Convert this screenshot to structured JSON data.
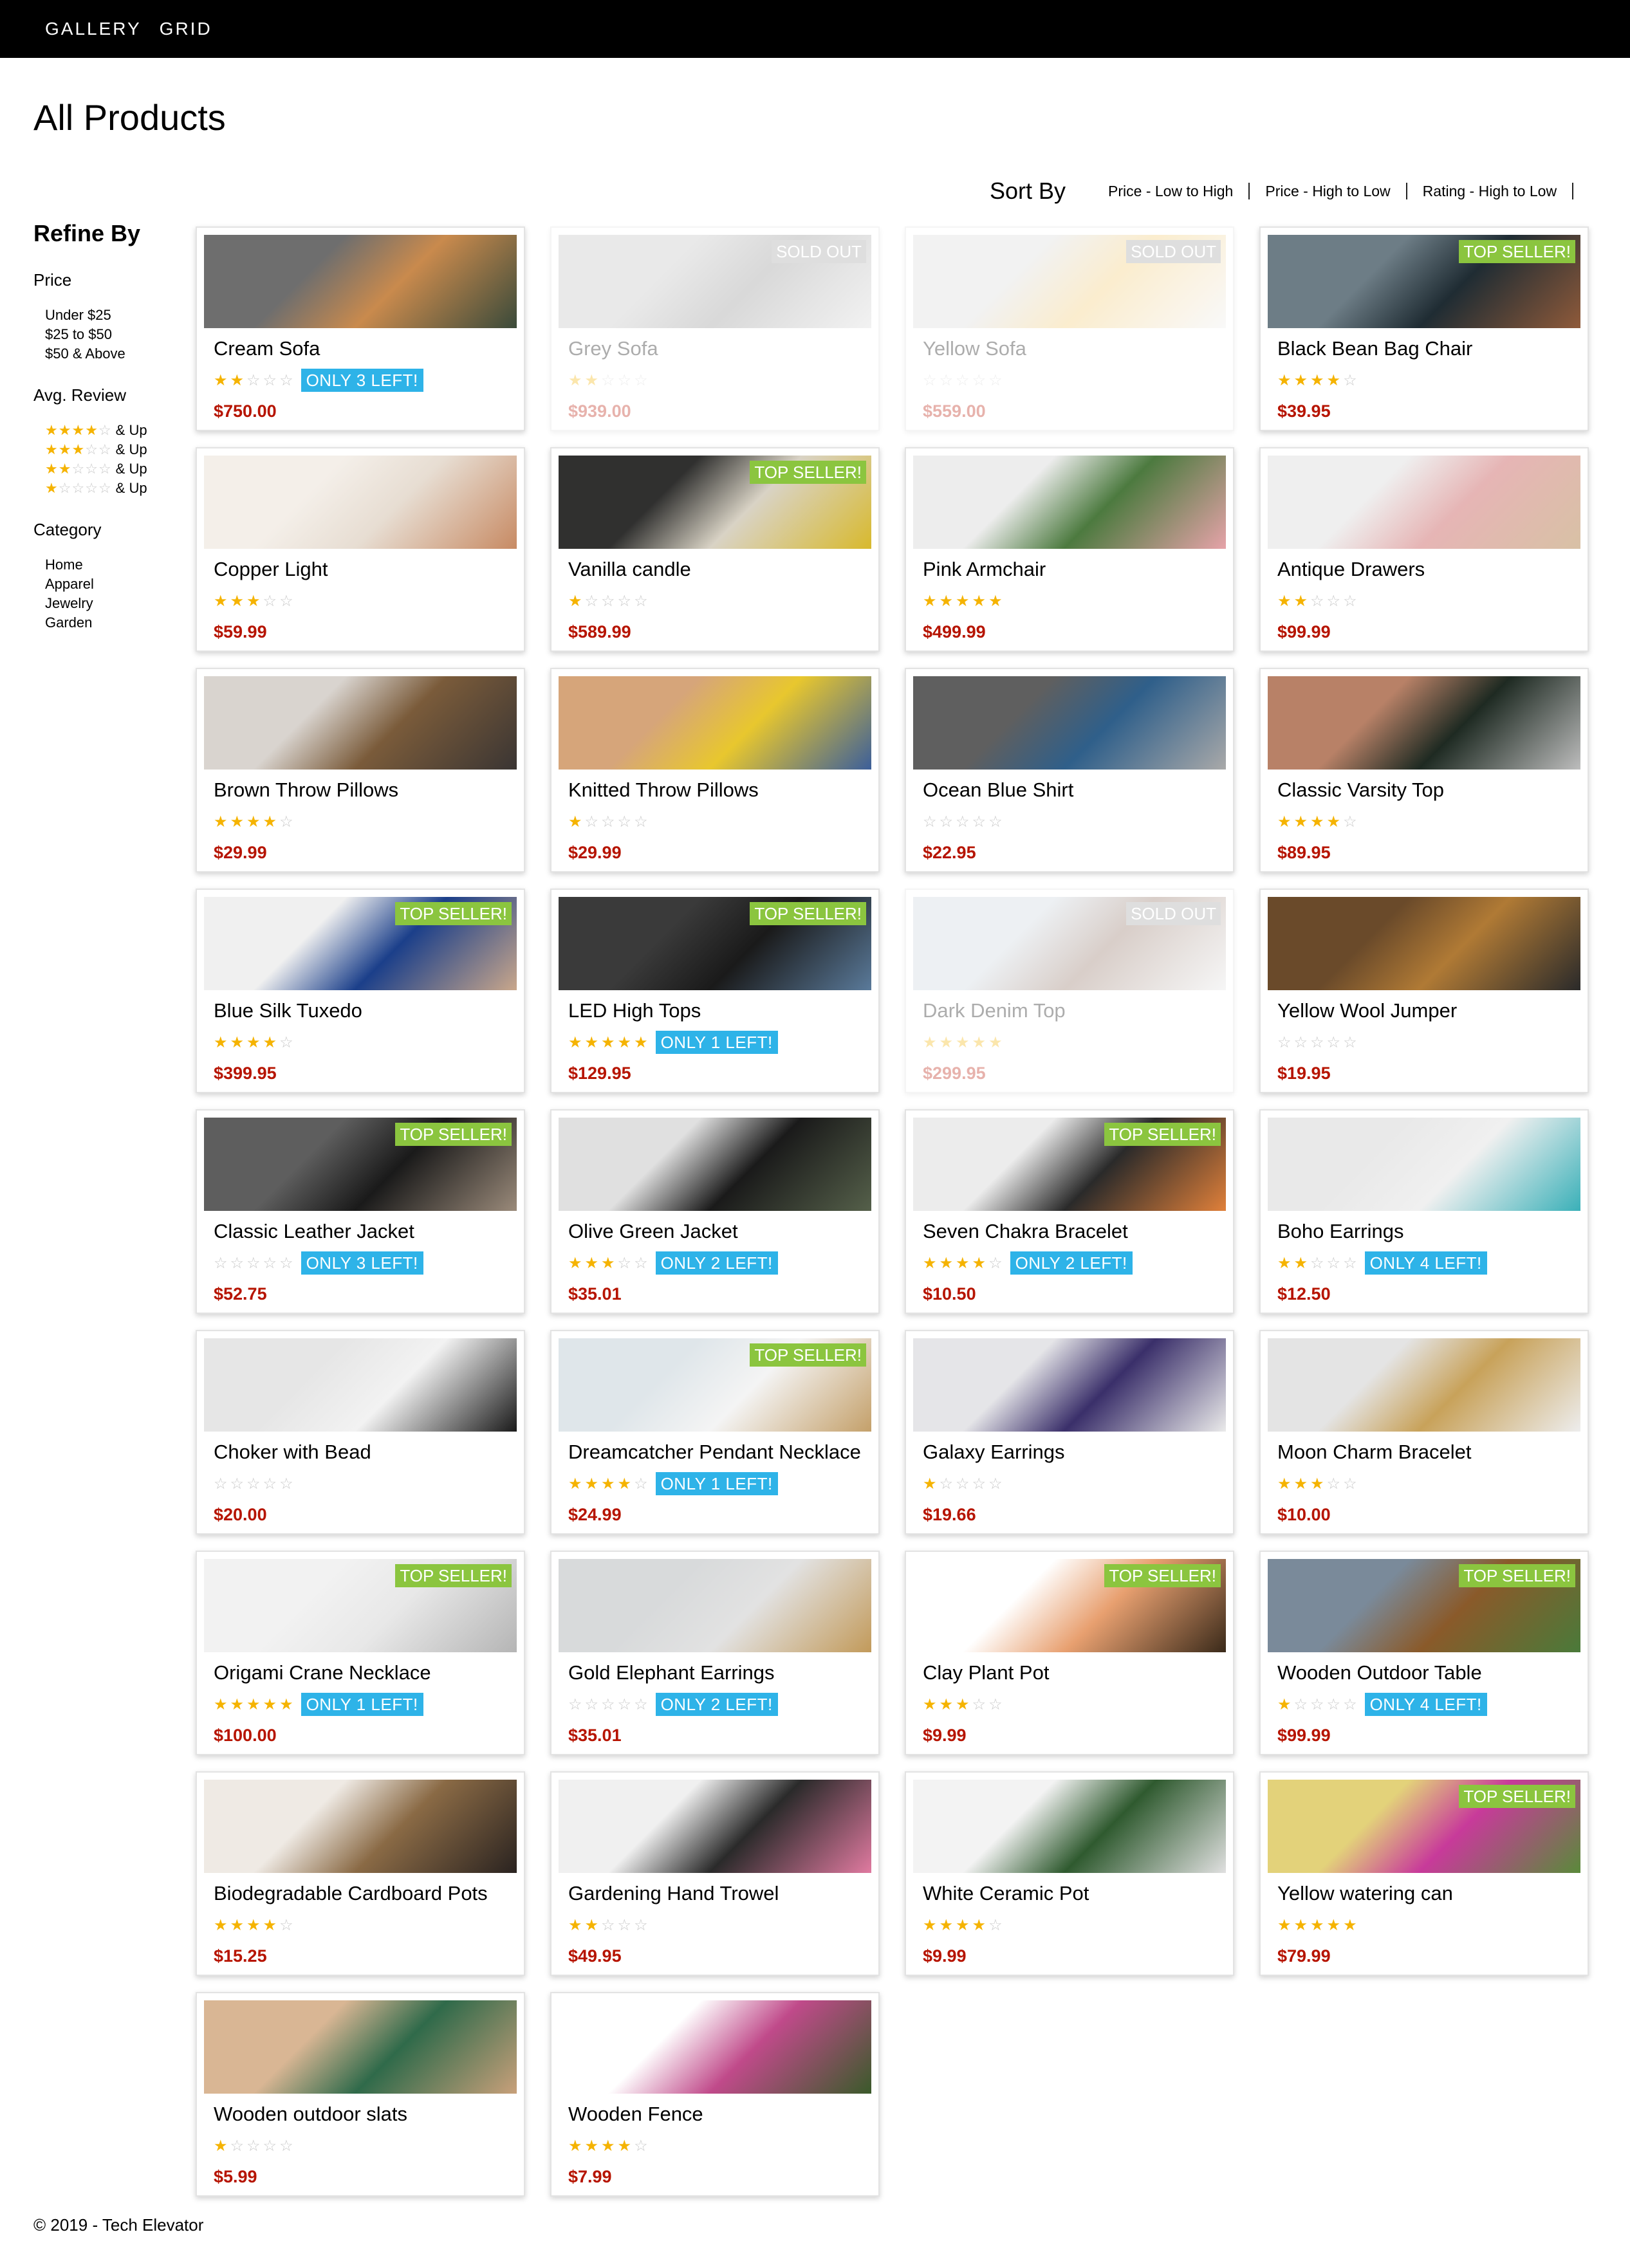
{
  "nav": {
    "gallery_label": "GALLERY",
    "grid_label": "GRID"
  },
  "page_title": "All Products",
  "sort": {
    "label": "Sort By",
    "options": [
      "Price - Low to High",
      "Price - High to Low",
      "Rating - High to Low"
    ]
  },
  "sidebar": {
    "title": "Refine By",
    "price_title": "Price",
    "price_options": [
      "Under $25",
      "$25 to $50",
      "$50 & Above"
    ],
    "review_title": "Avg. Review",
    "review_options": [
      {
        "stars": 4,
        "label": "& Up"
      },
      {
        "stars": 3,
        "label": "& Up"
      },
      {
        "stars": 2,
        "label": "& Up"
      },
      {
        "stars": 1,
        "label": "& Up"
      }
    ],
    "category_title": "Category",
    "category_options": [
      "Home",
      "Apparel",
      "Jewelry",
      "Garden"
    ]
  },
  "products": [
    {
      "name": "Cream Sofa",
      "rating": 2,
      "price": "$750.00",
      "badge": "",
      "stock": "ONLY 3 LEFT!",
      "sold_out": false,
      "img_colors": [
        "#6e6e6e",
        "#c98a4d",
        "#3a4a3a"
      ]
    },
    {
      "name": "Grey Sofa",
      "rating": 2,
      "price": "$939.00",
      "badge": "SOLD OUT",
      "stock": "",
      "sold_out": true,
      "img_colors": [
        "#bdbdbd",
        "#8a8a8a",
        "#d8d8d8"
      ]
    },
    {
      "name": "Yellow Sofa",
      "rating": 0,
      "price": "$559.00",
      "badge": "SOLD OUT",
      "stock": "",
      "sold_out": true,
      "img_colors": [
        "#d7d7d7",
        "#f3c86a",
        "#eeeeee"
      ]
    },
    {
      "name": "Black Bean Bag Chair",
      "rating": 4,
      "price": "$39.95",
      "badge": "TOP SELLER!",
      "stock": "",
      "sold_out": false,
      "img_colors": [
        "#6d7d86",
        "#1f2c33",
        "#8f5a3a"
      ]
    },
    {
      "name": "Copper Light",
      "rating": 3,
      "price": "$59.99",
      "badge": "",
      "stock": "",
      "sold_out": false,
      "img_colors": [
        "#f4efe9",
        "#e7ddd2",
        "#c78a63"
      ]
    },
    {
      "name": "Vanilla candle",
      "rating": 1,
      "price": "$589.99",
      "badge": "TOP SELLER!",
      "stock": "",
      "sold_out": false,
      "img_colors": [
        "#30302f",
        "#d9d3c5",
        "#d8b92d"
      ]
    },
    {
      "name": "Pink Armchair",
      "rating": 5,
      "price": "$499.99",
      "badge": "",
      "stock": "",
      "sold_out": false,
      "img_colors": [
        "#ededed",
        "#4c7a3f",
        "#e6a3a9"
      ]
    },
    {
      "name": "Antique Drawers",
      "rating": 2,
      "price": "$99.99",
      "badge": "",
      "stock": "",
      "sold_out": false,
      "img_colors": [
        "#efefef",
        "#e6b5b5",
        "#d8c1a5"
      ]
    },
    {
      "name": "Brown Throw Pillows",
      "rating": 4,
      "price": "$29.99",
      "badge": "",
      "stock": "",
      "sold_out": false,
      "img_colors": [
        "#d9d4cf",
        "#7a5b3a",
        "#3a3533"
      ]
    },
    {
      "name": "Knitted Throw Pillows",
      "rating": 1,
      "price": "$29.99",
      "badge": "",
      "stock": "",
      "sold_out": false,
      "img_colors": [
        "#d6a57a",
        "#e8c72e",
        "#3c5f9a"
      ]
    },
    {
      "name": "Ocean Blue Shirt",
      "rating": 0,
      "price": "$22.95",
      "badge": "",
      "stock": "",
      "sold_out": false,
      "img_colors": [
        "#5f5f5f",
        "#2f5f8a",
        "#a9a9a9"
      ]
    },
    {
      "name": "Classic Varsity Top",
      "rating": 4,
      "price": "$89.95",
      "badge": "",
      "stock": "",
      "sold_out": false,
      "img_colors": [
        "#b88167",
        "#1e2a22",
        "#bdbdbd"
      ]
    },
    {
      "name": "Blue Silk Tuxedo",
      "rating": 4,
      "price": "$399.95",
      "badge": "TOP SELLER!",
      "stock": "",
      "sold_out": false,
      "img_colors": [
        "#f0f0f0",
        "#1b3f8a",
        "#c9a78b"
      ]
    },
    {
      "name": "LED High Tops",
      "rating": 5,
      "price": "$129.95",
      "badge": "TOP SELLER!",
      "stock": "ONLY 1 LEFT!",
      "sold_out": false,
      "img_colors": [
        "#3a3a3a",
        "#1a1a1a",
        "#5a7a9a"
      ]
    },
    {
      "name": "Dark Denim Top",
      "rating": 5,
      "price": "$299.95",
      "badge": "SOLD OUT",
      "stock": "",
      "sold_out": true,
      "img_colors": [
        "#c9d3dc",
        "#8a6a5a",
        "#e5e5e5"
      ]
    },
    {
      "name": "Yellow Wool Jumper",
      "rating": 0,
      "price": "$19.95",
      "badge": "",
      "stock": "",
      "sold_out": false,
      "img_colors": [
        "#6a4a2a",
        "#b07a35",
        "#2a2a2a"
      ]
    },
    {
      "name": "Classic Leather Jacket",
      "rating": 0,
      "price": "$52.75",
      "badge": "TOP SELLER!",
      "stock": "ONLY 3 LEFT!",
      "sold_out": false,
      "img_colors": [
        "#5e5e5e",
        "#1a1a1a",
        "#9a8a7a"
      ]
    },
    {
      "name": "Olive Green Jacket",
      "rating": 3,
      "price": "$35.01",
      "badge": "",
      "stock": "ONLY 2 LEFT!",
      "sold_out": false,
      "img_colors": [
        "#e0e0e0",
        "#1a1a1a",
        "#55604a"
      ]
    },
    {
      "name": "Seven Chakra Bracelet",
      "rating": 4,
      "price": "$10.50",
      "badge": "TOP SELLER!",
      "stock": "ONLY 2 LEFT!",
      "sold_out": false,
      "img_colors": [
        "#ececec",
        "#2a2a2a",
        "#e0803a"
      ]
    },
    {
      "name": "Boho Earrings",
      "rating": 2,
      "price": "$12.50",
      "badge": "",
      "stock": "ONLY 4 LEFT!",
      "sold_out": false,
      "img_colors": [
        "#e9e9e9",
        "#f0f0f0",
        "#3ab0b8"
      ]
    },
    {
      "name": "Choker with Bead",
      "rating": 0,
      "price": "$20.00",
      "badge": "",
      "stock": "",
      "sold_out": false,
      "img_colors": [
        "#e6e6e6",
        "#f2f2f2",
        "#1a1a1a"
      ]
    },
    {
      "name": "Dreamcatcher Pendant Necklace",
      "rating": 4,
      "price": "$24.99",
      "badge": "TOP SELLER!",
      "stock": "ONLY 1 LEFT!",
      "sold_out": false,
      "img_colors": [
        "#dfe6ea",
        "#f4f4f4",
        "#c4a06a"
      ]
    },
    {
      "name": "Galaxy Earrings",
      "rating": 1,
      "price": "$19.66",
      "badge": "",
      "stock": "",
      "sold_out": false,
      "img_colors": [
        "#e5e5e8",
        "#3a2f6a",
        "#eaeaea"
      ]
    },
    {
      "name": "Moon Charm Bracelet",
      "rating": 3,
      "price": "$10.00",
      "badge": "",
      "stock": "",
      "sold_out": false,
      "img_colors": [
        "#e4e4e4",
        "#c8a25a",
        "#ededed"
      ]
    },
    {
      "name": "Origami Crane Necklace",
      "rating": 5,
      "price": "$100.00",
      "badge": "TOP SELLER!",
      "stock": "ONLY 1 LEFT!",
      "sold_out": false,
      "img_colors": [
        "#f2f2f2",
        "#e8e8e8",
        "#b5b5b5"
      ]
    },
    {
      "name": "Gold Elephant Earrings",
      "rating": 0,
      "price": "$35.01",
      "badge": "",
      "stock": "ONLY 2 LEFT!",
      "sold_out": false,
      "img_colors": [
        "#d8dadb",
        "#e2e2e2",
        "#c29a5a"
      ]
    },
    {
      "name": "Clay Plant Pot",
      "rating": 3,
      "price": "$9.99",
      "badge": "TOP SELLER!",
      "stock": "",
      "sold_out": false,
      "img_colors": [
        "#ffffff",
        "#e8a070",
        "#3a2a1a"
      ]
    },
    {
      "name": "Wooden Outdoor Table",
      "rating": 1,
      "price": "$99.99",
      "badge": "TOP SELLER!",
      "stock": "ONLY 4 LEFT!",
      "sold_out": false,
      "img_colors": [
        "#7a8a9a",
        "#8a5a2a",
        "#4a7a3a"
      ]
    },
    {
      "name": "Biodegradable Cardboard Pots",
      "rating": 4,
      "price": "$15.25",
      "badge": "",
      "stock": "",
      "sold_out": false,
      "img_colors": [
        "#efeae4",
        "#8a6a45",
        "#2a2320"
      ]
    },
    {
      "name": "Gardening Hand Trowel",
      "rating": 2,
      "price": "$49.95",
      "badge": "",
      "stock": "",
      "sold_out": false,
      "img_colors": [
        "#f0f0f0",
        "#2a2a2a",
        "#e07aa0"
      ]
    },
    {
      "name": "White Ceramic Pot",
      "rating": 4,
      "price": "$9.99",
      "badge": "",
      "stock": "",
      "sold_out": false,
      "img_colors": [
        "#f3f3f3",
        "#2f5a2f",
        "#e0e0e0"
      ]
    },
    {
      "name": "Yellow watering can",
      "rating": 5,
      "price": "$79.99",
      "badge": "TOP SELLER!",
      "stock": "",
      "sold_out": false,
      "img_colors": [
        "#e3d27a",
        "#c83a9a",
        "#5a8a3a"
      ]
    },
    {
      "name": "Wooden outdoor slats",
      "rating": 1,
      "price": "$5.99",
      "badge": "",
      "stock": "",
      "sold_out": false,
      "img_colors": [
        "#d9b694",
        "#2f6a4a",
        "#c8a07a"
      ]
    },
    {
      "name": "Wooden Fence",
      "rating": 4,
      "price": "$7.99",
      "badge": "",
      "stock": "",
      "sold_out": false,
      "img_colors": [
        "#ffffff",
        "#c04a8a",
        "#3a5a2a"
      ]
    }
  ],
  "footer": "© 2019 - Tech Elevator"
}
